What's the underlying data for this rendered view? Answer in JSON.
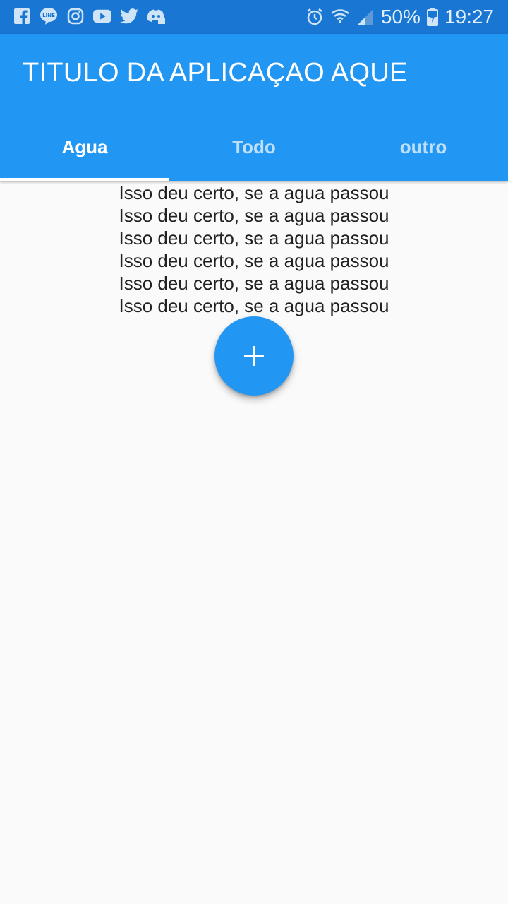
{
  "status_bar": {
    "notification_icons": [
      "facebook-icon",
      "line-icon",
      "instagram-icon",
      "youtube-icon",
      "twitter-icon",
      "discord-icon"
    ],
    "battery": "50%",
    "time": "19:27"
  },
  "app_bar": {
    "title": "TITULO DA APLICAÇAO AQUE",
    "background": "#2196f3"
  },
  "tabs": [
    {
      "label": "Agua",
      "selected": true
    },
    {
      "label": "Todo",
      "selected": false
    },
    {
      "label": "outro",
      "selected": false
    }
  ],
  "content": {
    "lines": [
      "Isso deu certo, se a agua passou",
      "Isso deu certo, se a agua passou",
      "Isso deu certo, se a agua passou",
      "Isso deu certo, se a agua passou",
      "Isso deu certo, se a agua passou",
      "Isso deu certo, se a agua passou"
    ]
  },
  "fab": {
    "icon": "plus-icon",
    "color": "#2196f3"
  }
}
